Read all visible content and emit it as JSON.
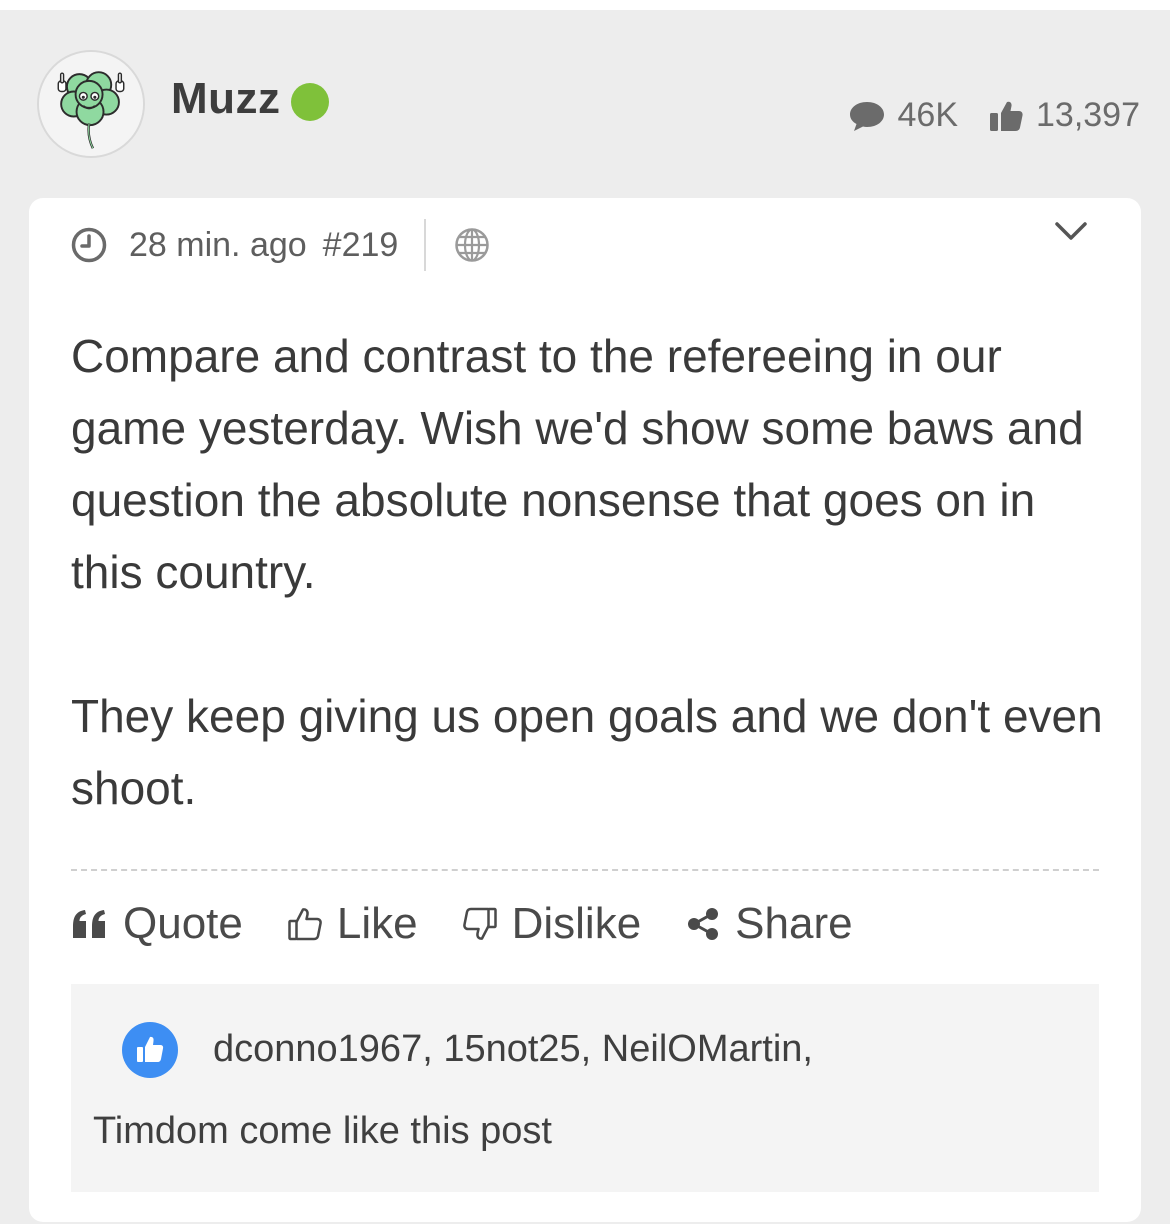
{
  "user": {
    "name": "Muzz",
    "online_color": "#7fc13a",
    "avatar_icon": "shamrock-avatar-icon"
  },
  "stats": {
    "posts": "46K",
    "likes": "13,397"
  },
  "post": {
    "time": "28 min. ago",
    "number": "#219",
    "paragraphs": [
      "Compare and contrast to the refereeing in our game yesterday. Wish we'd show some baws and question the absolute nonsense that goes on in this country.",
      "They keep giving us open goals and we don't even shoot."
    ]
  },
  "actions": {
    "quote": "Quote",
    "like": "Like",
    "dislike": "Dislike",
    "share": "Share"
  },
  "likes": {
    "users": "dconno1967, 15not25, NeilOMartin,",
    "suffix": "Timdom come like this post",
    "badge_color": "#3d8ef3"
  }
}
